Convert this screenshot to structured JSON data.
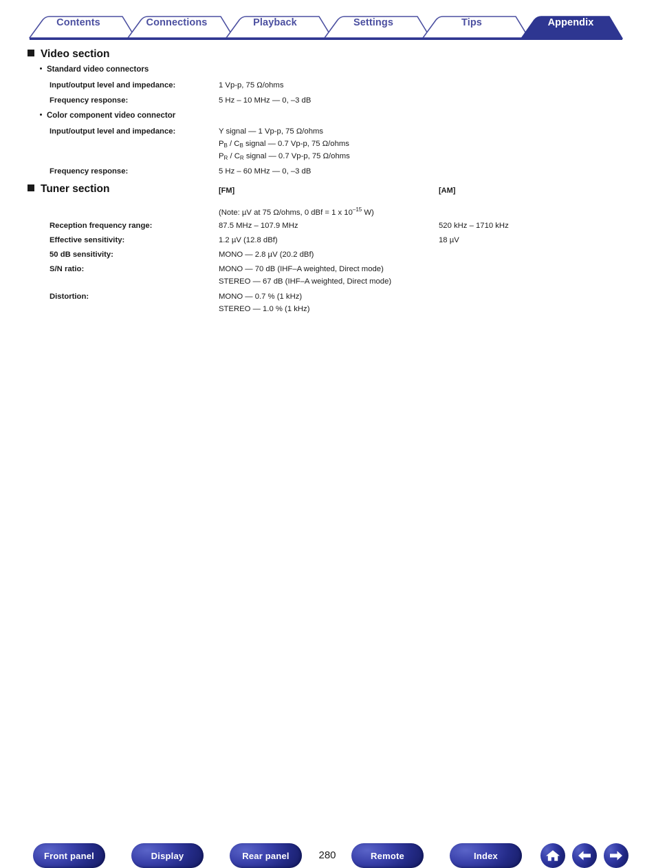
{
  "tabs": [
    {
      "label": "Contents",
      "active": false
    },
    {
      "label": "Connections",
      "active": false
    },
    {
      "label": "Playback",
      "active": false
    },
    {
      "label": "Settings",
      "active": false
    },
    {
      "label": "Tips",
      "active": false
    },
    {
      "label": "Appendix",
      "active": true
    }
  ],
  "colors": {
    "tab_text": "#4b4fa0",
    "tab_active_bg": "#2e3691",
    "tab_border": "#4b4fa0",
    "rule": "#2e3691",
    "button_blue": "#2e3691",
    "text": "#1a1a1a"
  },
  "sections": {
    "video": {
      "heading": "Video section",
      "groups": [
        {
          "title": "Standard video connectors",
          "rows": [
            {
              "label": "Input/output level and impedance:",
              "fm": [
                "1 Vp-p, 75 Ω/ohms"
              ]
            },
            {
              "label": "Frequency response:",
              "fm": [
                "5 Hz – 10 MHz — 0, –3 dB"
              ]
            }
          ]
        },
        {
          "title": "Color component video connector",
          "rows": [
            {
              "label": "Input/output level and impedance:",
              "fm": [
                "Y signal — 1 Vp-p, 75 Ω/ohms",
                "P_B / C_B signal — 0.7 Vp-p, 75 Ω/ohms",
                "P_R / C_R signal — 0.7 Vp-p, 75 Ω/ohms"
              ]
            },
            {
              "label": "Frequency response:",
              "fm": [
                "5 Hz – 60 MHz — 0, –3 dB"
              ]
            }
          ]
        }
      ]
    },
    "tuner": {
      "heading": "Tuner section",
      "col_fm_header": "[FM]",
      "col_am_header": "[AM]",
      "note": "(Note: µV at 75 Ω/ohms, 0 dBf = 1 x 10⁻¹⁵ W)",
      "note_parts": {
        "pre": "(Note: µV at 75 Ω/ohms, 0 dBf = 1 x 10",
        "sup": "–15",
        " post": " W)",
        "post": " W)"
      },
      "rows": [
        {
          "label": "Reception frequency range:",
          "fm": [
            "87.5 MHz – 107.9 MHz"
          ],
          "am": [
            "520 kHz – 1710 kHz"
          ]
        },
        {
          "label": "Effective sensitivity:",
          "fm": [
            "1.2 µV (12.8 dBf)"
          ],
          "am": [
            "18 µV"
          ]
        },
        {
          "label": "50 dB sensitivity:",
          "fm": [
            "MONO — 2.8 µV (20.2 dBf)"
          ],
          "am": []
        },
        {
          "label": "S/N ratio:",
          "fm": [
            "MONO — 70 dB (IHF–A weighted, Direct mode)",
            "STEREO — 67 dB (IHF–A weighted, Direct mode)"
          ],
          "am": []
        },
        {
          "label": "Distortion:",
          "fm": [
            "MONO — 0.7 % (1 kHz)",
            "STEREO — 1.0 % (1 kHz)"
          ],
          "am": []
        }
      ]
    }
  },
  "footer": {
    "buttons": [
      {
        "label": "Front panel"
      },
      {
        "label": "Display"
      },
      {
        "label": "Rear panel"
      },
      {
        "label": "Remote"
      },
      {
        "label": "Index"
      }
    ],
    "page_number": "280",
    "icons": [
      {
        "name": "home-icon"
      },
      {
        "name": "arrow-left-icon"
      },
      {
        "name": "arrow-right-icon"
      }
    ]
  }
}
